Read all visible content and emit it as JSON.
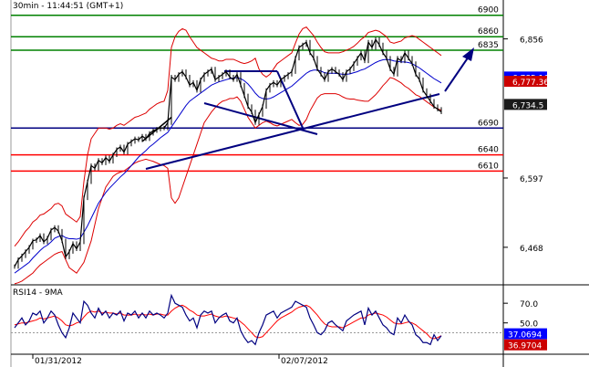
{
  "header": {
    "title": "30min - 11:44:51 (GMT+1)"
  },
  "colors": {
    "price": "#000000",
    "bollinger": "#dd0000",
    "ma": "#0000cc",
    "green_level": "#008000",
    "red_level": "#ff0000",
    "blue_level": "#000080",
    "trend": "#000080",
    "rsi": "#000080",
    "rsi_ma": "#ff0000",
    "badge_blue": "#0000ff",
    "badge_red": "#cc0000",
    "badge_dark": "#1a1a1a"
  },
  "chart_data": [
    {
      "type": "line",
      "title": "30min - 11:44:51 (GMT+1)",
      "ylim": [
        6410,
        6925
      ],
      "y_ticks": [
        "6,856",
        "6,597",
        "6,468"
      ],
      "x_ticks": [
        "01/31/2012",
        "02/07/2012"
      ],
      "levels": [
        {
          "label": "6900",
          "value": 6900,
          "color": "green"
        },
        {
          "label": "6860",
          "value": 6860,
          "color": "green"
        },
        {
          "label": "6835",
          "value": 6835,
          "color": "green"
        },
        {
          "label": "6690",
          "value": 6690,
          "color": "navy"
        },
        {
          "label": "6640",
          "value": 6640,
          "color": "red"
        },
        {
          "label": "6610",
          "value": 6610,
          "color": "red"
        }
      ],
      "price_badges": [
        {
          "label": "6,785.16",
          "value": 6785,
          "color": "blue"
        },
        {
          "label": "6,777.36",
          "value": 6777,
          "color": "red"
        },
        {
          "label": "6,734.5",
          "value": 6734,
          "color": "dark"
        }
      ],
      "x": [
        0,
        4,
        8,
        12,
        16,
        20,
        24,
        28,
        32,
        36,
        40,
        44,
        48,
        52,
        56,
        60,
        64,
        68,
        72,
        76,
        80,
        84,
        88,
        92,
        96,
        100,
        104,
        108,
        112,
        116,
        120,
        124,
        128,
        132,
        136,
        140,
        144,
        148,
        152,
        156,
        160,
        164,
        168,
        172,
        176,
        180,
        184,
        188,
        192,
        196,
        200,
        204,
        208,
        212,
        216,
        220,
        224,
        228,
        232,
        236,
        240,
        244,
        248,
        252,
        256,
        260,
        264,
        268,
        272,
        276,
        280,
        284,
        288,
        292,
        296,
        300,
        304,
        308,
        312,
        316,
        320,
        324,
        328,
        332,
        336,
        340,
        344,
        348,
        352,
        356,
        360,
        364,
        368,
        372,
        376,
        380,
        384,
        388,
        392,
        396,
        400,
        404,
        408,
        412,
        416,
        420,
        424,
        428,
        432,
        436,
        440,
        444,
        448,
        452,
        456,
        460,
        464,
        468
      ],
      "series": [
        {
          "values": [
            6432,
            6445,
            6452,
            6460,
            6468,
            6480,
            6482,
            6490,
            6478,
            6485,
            6500,
            6505,
            6498,
            6480,
            6450,
            6460,
            6475,
            6465,
            6478,
            6560,
            6590,
            6620,
            6615,
            6630,
            6625,
            6635,
            6628,
            6640,
            6650,
            6655,
            6645,
            6660,
            6665,
            6670,
            6668,
            6675,
            6670,
            6680,
            6685,
            6688,
            6690,
            6690,
            6700,
            6785,
            6780,
            6790,
            6795,
            6785,
            6770,
            6775,
            6760,
            6780,
            6790,
            6795,
            6800,
            6780,
            6785,
            6790,
            6795,
            6785,
            6780,
            6790,
            6770,
            6750,
            6730,
            6720,
            6700,
            6715,
            6730,
            6760,
            6770,
            6775,
            6770,
            6780,
            6785,
            6790,
            6795,
            6820,
            6840,
            6845,
            6850,
            6830,
            6820,
            6800,
            6790,
            6780,
            6795,
            6800,
            6795,
            6790,
            6780,
            6795,
            6800,
            6810,
            6820,
            6830,
            6815,
            6850,
            6840,
            6855,
            6845,
            6830,
            6820,
            6800,
            6790,
            6820,
            6815,
            6830,
            6820,
            6810,
            6790,
            6780,
            6760,
            6750,
            6740,
            6730,
            6725,
            6720
          ]
        },
        {
          "values": [
            6420,
            6425,
            6430,
            6435,
            6440,
            6448,
            6455,
            6462,
            6468,
            6472,
            6478,
            6485,
            6488,
            6490,
            6486,
            6484,
            6484,
            6483,
            6485,
            6496,
            6508,
            6522,
            6536,
            6550,
            6560,
            6570,
            6578,
            6585,
            6592,
            6599,
            6605,
            6612,
            6620,
            6628,
            6636,
            6642,
            6648,
            6655,
            6660,
            6666,
            6672,
            6677,
            6682,
            6692,
            6702,
            6712,
            6722,
            6732,
            6740,
            6745,
            6750,
            6755,
            6760,
            6765,
            6770,
            6773,
            6776,
            6778,
            6780,
            6782,
            6783,
            6784,
            6782,
            6778,
            6772,
            6764,
            6755,
            6748,
            6745,
            6744,
            6745,
            6748,
            6752,
            6756,
            6760,
            6764,
            6768,
            6774,
            6780,
            6786,
            6792,
            6796,
            6798,
            6798,
            6796,
            6793,
            6792,
            6792,
            6792,
            6791,
            6790,
            6790,
            6791,
            6793,
            6795,
            6798,
            6800,
            6804,
            6808,
            6812,
            6815,
            6817,
            6818,
            6817,
            6815,
            6814,
            6813,
            6813,
            6812,
            6810,
            6806,
            6802,
            6797,
            6792,
            6787,
            6782,
            6778,
            6774
          ]
        },
        {
          "values": [
            6470,
            6478,
            6488,
            6498,
            6505,
            6515,
            6520,
            6528,
            6530,
            6535,
            6540,
            6548,
            6550,
            6545,
            6530,
            6525,
            6520,
            6515,
            6525,
            6590,
            6640,
            6670,
            6680,
            6690,
            6690,
            6690,
            6688,
            6690,
            6695,
            6698,
            6695,
            6700,
            6705,
            6710,
            6712,
            6715,
            6718,
            6725,
            6730,
            6735,
            6738,
            6740,
            6760,
            6840,
            6860,
            6870,
            6875,
            6872,
            6860,
            6850,
            6840,
            6835,
            6830,
            6825,
            6820,
            6818,
            6815,
            6815,
            6818,
            6818,
            6818,
            6815,
            6812,
            6810,
            6812,
            6815,
            6820,
            6800,
            6790,
            6785,
            6790,
            6800,
            6810,
            6815,
            6820,
            6825,
            6830,
            6848,
            6865,
            6875,
            6878,
            6870,
            6862,
            6850,
            6840,
            6832,
            6830,
            6830,
            6830,
            6830,
            6832,
            6835,
            6838,
            6842,
            6848,
            6855,
            6860,
            6868,
            6870,
            6872,
            6870,
            6865,
            6860,
            6850,
            6848,
            6850,
            6852,
            6858,
            6860,
            6862,
            6860,
            6855,
            6850,
            6845,
            6840,
            6835,
            6830,
            6825
          ]
        },
        {
          "values": [
            6400,
            6402,
            6405,
            6410,
            6415,
            6420,
            6428,
            6435,
            6440,
            6445,
            6450,
            6455,
            6458,
            6460,
            6445,
            6430,
            6425,
            6420,
            6430,
            6440,
            6460,
            6480,
            6510,
            6540,
            6560,
            6580,
            6590,
            6600,
            6605,
            6608,
            6610,
            6615,
            6620,
            6625,
            6628,
            6630,
            6632,
            6630,
            6628,
            6625,
            6622,
            6620,
            6615,
            6560,
            6550,
            6560,
            6580,
            6600,
            6620,
            6640,
            6660,
            6680,
            6700,
            6710,
            6720,
            6728,
            6735,
            6740,
            6742,
            6745,
            6745,
            6748,
            6740,
            6725,
            6710,
            6700,
            6690,
            6695,
            6700,
            6703,
            6700,
            6696,
            6694,
            6697,
            6700,
            6703,
            6706,
            6700,
            6695,
            6697,
            6706,
            6722,
            6734,
            6746,
            6752,
            6754,
            6754,
            6754,
            6754,
            6752,
            6748,
            6745,
            6744,
            6744,
            6742,
            6741,
            6740,
            6740,
            6746,
            6752,
            6760,
            6769,
            6776,
            6784,
            6782,
            6778,
            6774,
            6768,
            6764,
            6758,
            6752,
            6749,
            6744,
            6739,
            6734,
            6729,
            6726,
            6723
          ]
        }
      ],
      "zigzag_overlay": [
        {
          "x": 140,
          "value": 6665
        },
        {
          "x": 160,
          "value": 6693
        },
        {
          "x": 172,
          "value": 6710
        }
      ]
    },
    {
      "type": "line",
      "title": "RSI14 - 9MA",
      "ylim": [
        20,
        85
      ],
      "y_ticks": [
        "70.0",
        "50.0"
      ],
      "price_badges": [
        {
          "label": "37.0694",
          "value": 37.07,
          "color": "blue"
        },
        {
          "label": "36.9704",
          "value": 36.97,
          "color": "red"
        }
      ],
      "x": [
        0,
        4,
        8,
        12,
        16,
        20,
        24,
        28,
        32,
        36,
        40,
        44,
        48,
        52,
        56,
        60,
        64,
        68,
        72,
        76,
        80,
        84,
        88,
        92,
        96,
        100,
        104,
        108,
        112,
        116,
        120,
        124,
        128,
        132,
        136,
        140,
        144,
        148,
        152,
        156,
        160,
        164,
        168,
        172,
        176,
        180,
        184,
        188,
        192,
        196,
        200,
        204,
        208,
        212,
        216,
        220,
        224,
        228,
        232,
        236,
        240,
        244,
        248,
        252,
        256,
        260,
        264,
        268,
        272,
        276,
        280,
        284,
        288,
        292,
        296,
        300,
        304,
        308,
        312,
        316,
        320,
        324,
        328,
        332,
        336,
        340,
        344,
        348,
        352,
        356,
        360,
        364,
        368,
        372,
        376,
        380,
        384,
        388,
        392,
        396,
        400,
        404,
        408,
        412,
        416,
        420,
        424,
        428,
        432,
        436,
        440,
        444,
        448,
        452,
        456,
        460,
        464,
        468
      ],
      "series": [
        {
          "values": [
            45,
            50,
            55,
            48,
            52,
            60,
            58,
            62,
            50,
            55,
            62,
            58,
            48,
            40,
            35,
            45,
            60,
            55,
            50,
            72,
            68,
            60,
            55,
            65,
            58,
            62,
            55,
            60,
            58,
            62,
            52,
            60,
            58,
            62,
            55,
            60,
            55,
            62,
            58,
            60,
            58,
            55,
            60,
            78,
            70,
            68,
            66,
            58,
            52,
            55,
            45,
            58,
            62,
            60,
            62,
            50,
            55,
            58,
            60,
            52,
            50,
            55,
            42,
            35,
            30,
            32,
            28,
            40,
            48,
            58,
            60,
            62,
            55,
            60,
            62,
            64,
            66,
            72,
            70,
            68,
            66,
            55,
            48,
            40,
            38,
            42,
            50,
            52,
            48,
            45,
            42,
            52,
            55,
            58,
            60,
            62,
            48,
            65,
            58,
            62,
            55,
            48,
            45,
            40,
            38,
            55,
            50,
            58,
            52,
            48,
            38,
            35,
            30,
            30,
            28,
            38,
            32,
            37
          ]
        },
        {
          "values": [
            48,
            49,
            50,
            50,
            51,
            52,
            53,
            55,
            54,
            55,
            56,
            57,
            55,
            52,
            48,
            47,
            48,
            50,
            51,
            56,
            60,
            62,
            61,
            62,
            60,
            61,
            60,
            60,
            59,
            60,
            58,
            58,
            58,
            59,
            58,
            59,
            58,
            59,
            58,
            59,
            59,
            58,
            58,
            62,
            65,
            67,
            68,
            66,
            63,
            61,
            58,
            57,
            57,
            58,
            59,
            57,
            56,
            56,
            57,
            56,
            55,
            54,
            51,
            48,
            44,
            40,
            36,
            35,
            36,
            40,
            44,
            48,
            52,
            55,
            57,
            59,
            61,
            64,
            66,
            67,
            68,
            66,
            62,
            58,
            53,
            49,
            47,
            46,
            46,
            46,
            45,
            47,
            49,
            51,
            53,
            55,
            55,
            58,
            59,
            60,
            59,
            58,
            56,
            53,
            50,
            49,
            49,
            50,
            51,
            50,
            48,
            45,
            42,
            39,
            35,
            34,
            35,
            36.97
          ]
        }
      ],
      "hline": 40
    }
  ]
}
